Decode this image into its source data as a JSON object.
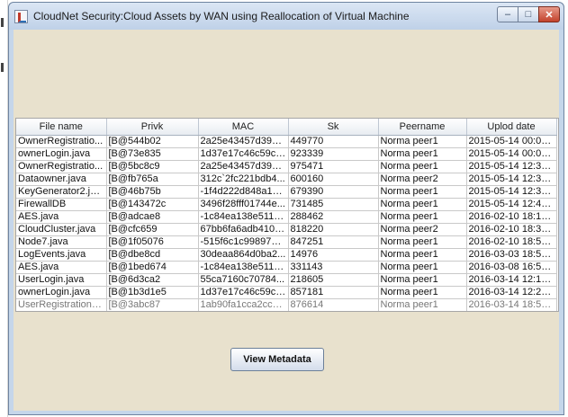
{
  "window": {
    "title": "CloudNet Security:Cloud Assets by WAN using Reallocation of Virtual Machine",
    "controls": {
      "minimize": "–",
      "maximize": "□",
      "close": "✕"
    }
  },
  "table": {
    "columns": [
      "File name",
      "Privk",
      "MAC",
      "Sk",
      "Peername",
      "Uplod date"
    ],
    "rows": [
      [
        "OwnerRegistratio...",
        "[B@544b02",
        "2a25e43457d39df...",
        "449770",
        "Norma peer1",
        "2015-05-14 00:05:..."
      ],
      [
        "ownerLogin.java",
        "[B@73e835",
        "1d37e17c46c59c8...",
        "923339",
        "Norma peer1",
        "2015-05-14 00:07:..."
      ],
      [
        "OwnerRegistratio...",
        "[B@5bc8c9",
        "2a25e43457d39df...",
        "975471",
        "Norma peer1",
        "2015-05-14 12:31:..."
      ],
      [
        "Dataowner.java",
        "[B@fb765a",
        "312c`2fc221bdb4...",
        "600160",
        "Norma peer2",
        "2015-05-14 12:33:..."
      ],
      [
        "KeyGenerator2.java",
        "[B@46b75b",
        "-1f4d222d848a15...",
        "679390",
        "Norma peer1",
        "2015-05-14 12:38:..."
      ],
      [
        "FirewallDB",
        "[B@143472c",
        "3496f28fff01744e...",
        "731485",
        "Norma peer1",
        "2015-05-14 12:40:..."
      ],
      [
        "AES.java",
        "[B@adcae8",
        "-1c84ea138e5118...",
        "288462",
        "Norma peer1",
        "2016-02-10 18:14:..."
      ],
      [
        "CloudCluster.java",
        "[B@cfc659",
        "67bb6fa6adb410c...",
        "818220",
        "Norma peer2",
        "2016-02-10 18:33:..."
      ],
      [
        "Node7.java",
        "[B@1f05076",
        "-515f6c1c99897cc...",
        "847251",
        "Norma peer1",
        "2016-02-10 18:53:..."
      ],
      [
        "LogEvents.java",
        "[B@dbe8cd",
        "30deaa864d0ba2...",
        "14976",
        "Norma peer1",
        "2016-03-03 18:57:..."
      ],
      [
        "AES.java",
        "[B@1bed674",
        "-1c84ea138e5118...",
        "331143",
        "Norma peer1",
        "2016-03-08 16:54:..."
      ],
      [
        "UserLogin.java",
        "[B@6d3ca2",
        "55ca7160c70784...",
        "218605",
        "Norma peer1",
        "2016-03-14 12:10:..."
      ],
      [
        "ownerLogin.java",
        "[B@1b3d1e5",
        "1d37e17c46c59c8...",
        "857181",
        "Norma peer1",
        "2016-03-14 12:25:..."
      ],
      [
        "UserRegistration.j...",
        "[B@3abc87",
        "1ab90fa1cca2cc3f...",
        "876614",
        "Norma peer1",
        "2016-03-14 18:52:..."
      ]
    ]
  },
  "actions": {
    "view_metadata": "View Metadata"
  }
}
